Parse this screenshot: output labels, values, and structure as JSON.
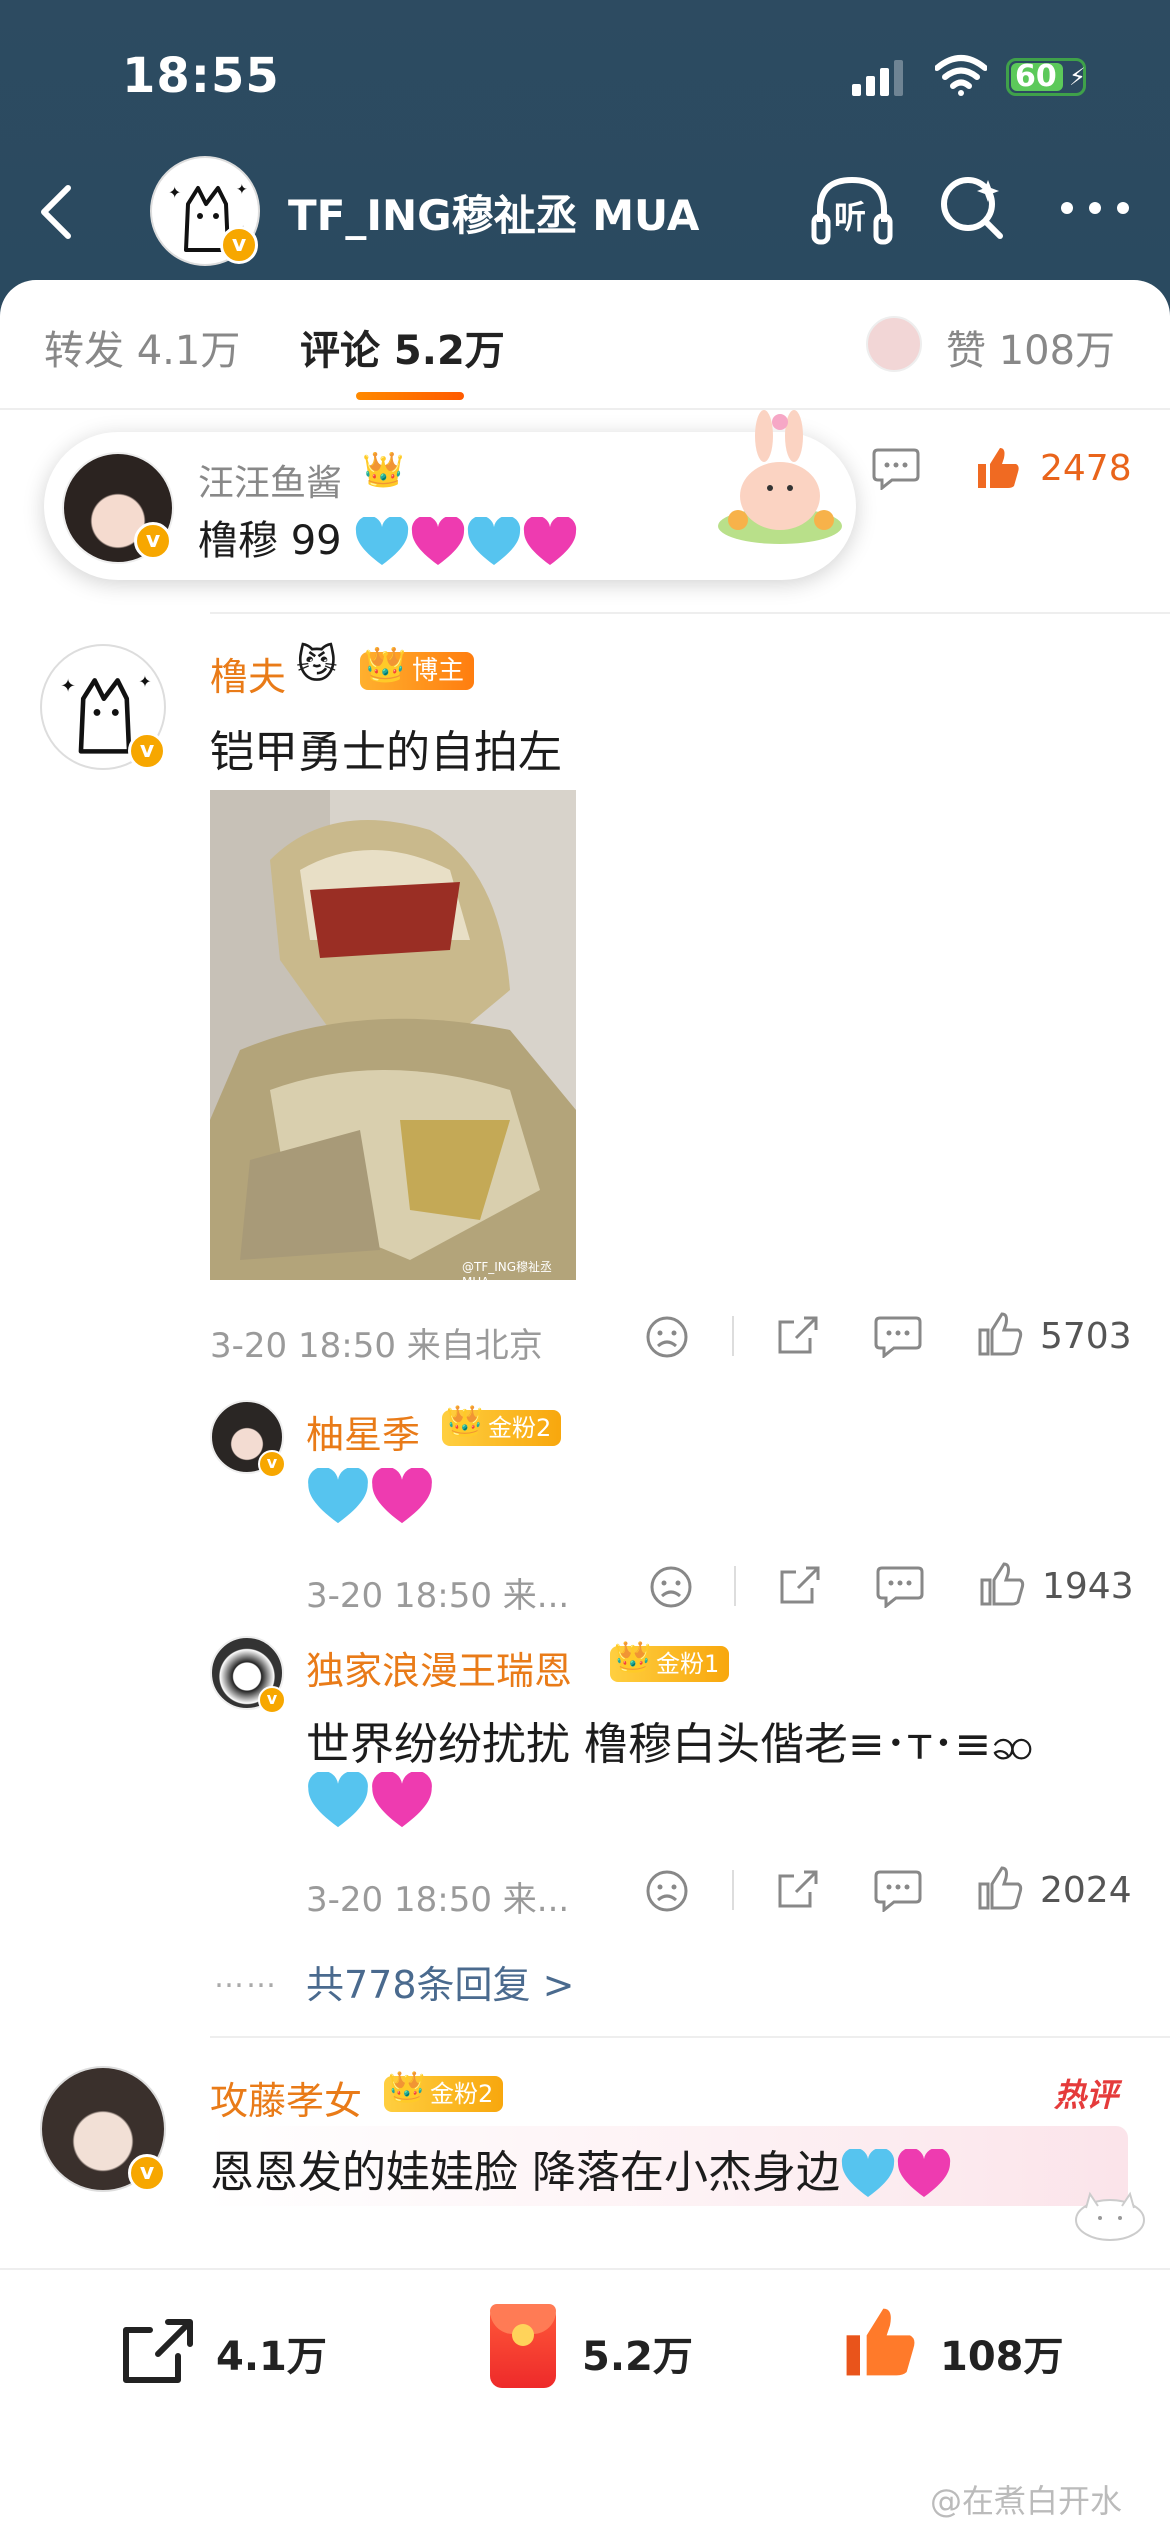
{
  "status_bar": {
    "time": "18:55",
    "battery": "60"
  },
  "header": {
    "title": "TF_ING穆祉丞 MUA",
    "listen_label": "听"
  },
  "tabs": [
    {
      "label": "转发 4.1万"
    },
    {
      "label": "评论 5.2万"
    },
    {
      "label": "赞 108万"
    }
  ],
  "popup": {
    "name": "汪汪鱼酱",
    "text": "橹穆 99",
    "likes": "2478"
  },
  "comments": [
    {
      "name": "橹夫",
      "name_emoji": "😼",
      "badge": "博主",
      "text": "铠甲勇士的自拍左",
      "photo_watermark": "@TF_ING穆祉丞MUA",
      "meta": "3-20 18:50 来自北京",
      "likes": "5703",
      "replies": [
        {
          "name": "柚星季",
          "badge": "金粉2",
          "text": "",
          "meta": "3-20 18:50 来...",
          "likes": "1943"
        },
        {
          "name": "独家浪漫王瑞恩",
          "badge": "金粉1",
          "text": "世界纷纷扰扰 橹穆白头偕老≡･ᴛ･≡ဆ",
          "meta": "3-20 18:50 来...",
          "likes": "2024"
        }
      ],
      "more_replies": "共778条回复 >"
    },
    {
      "name": "攻藤孝女",
      "badge": "金粉2",
      "hot_label": "热评",
      "text": "恩恩发的娃娃脸 降落在小杰身边"
    }
  ],
  "bottom_bar": {
    "repost": "4.1万",
    "comment": "5.2万",
    "like": "108万"
  },
  "watermark": "@在煮白开水",
  "colors": {
    "header_bg": "#2c4a60",
    "accent": "#ff6a00",
    "username": "#e97b18",
    "blue_heart": "#56c4ef",
    "pink_heart": "#ee3bb0"
  }
}
